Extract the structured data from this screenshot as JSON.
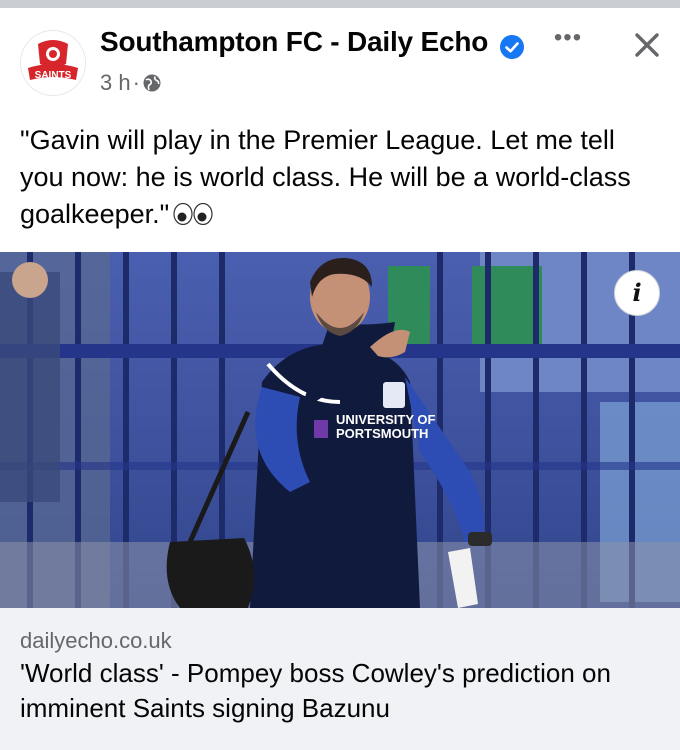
{
  "post": {
    "page_name": "Southampton FC - Daily Echo",
    "avatar_logo_text": "SAINTS",
    "time": "3 h",
    "separator": "·",
    "text": "\"Gavin will play in the Premier League. Let me tell you now: he is world class. He will be a world-class goalkeeper.\"",
    "emoji_icon": "eyes-emoji",
    "more_icon": "more-options-icon",
    "close_icon": "close-icon",
    "privacy_icon": "globe-icon"
  },
  "photo": {
    "shirt_sponsor": [
      "UNIVERSITY OF",
      "PORTSMOUTH"
    ],
    "info_label": "i"
  },
  "link_preview": {
    "domain": "dailyecho.co.uk",
    "headline": "'World class' - Pompey boss Cowley's prediction on imminent Saints signing Bazunu"
  },
  "colors": {
    "verified_blue": "#1877f2",
    "meta_gray": "#65676b",
    "preview_bg": "#f0f2f5",
    "brand_red": "#d6262b"
  }
}
